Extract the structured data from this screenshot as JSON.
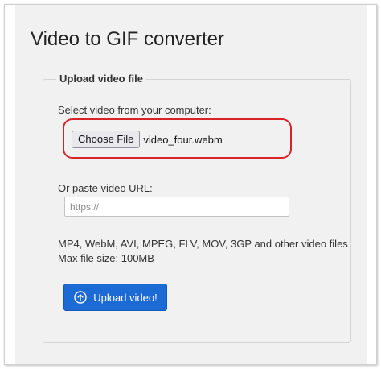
{
  "page": {
    "title": "Video to GIF converter"
  },
  "upload_section": {
    "legend": "Upload video file",
    "select_label": "Select video from your computer:",
    "choose_file_label": "Choose File",
    "selected_file": "video_four.webm",
    "url_label": "Or paste video URL:",
    "url_placeholder": "https://",
    "formats_text": "MP4, WebM, AVI, MPEG, FLV, MOV, 3GP and other video files",
    "max_size_text": "Max file size: 100MB",
    "upload_button_label": "Upload video!",
    "upload_icon": "cloud-upload-icon"
  },
  "colors": {
    "highlight_ring": "#d9232a",
    "primary_button": "#1c6ad3",
    "panel_background": "#f1f1f1"
  }
}
